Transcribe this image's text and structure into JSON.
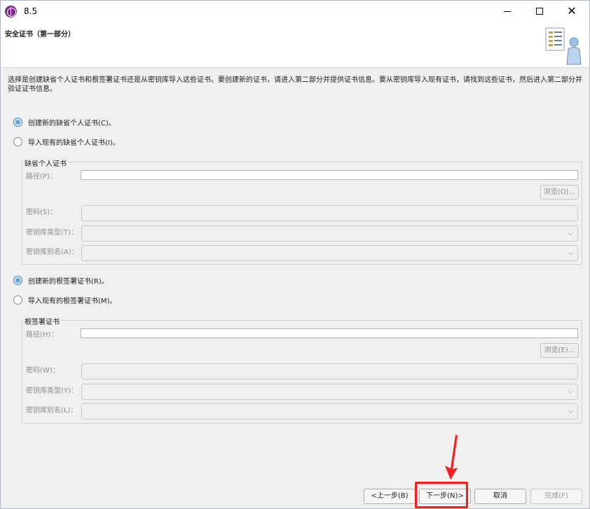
{
  "window": {
    "title": "8.5",
    "header_title": "安全证书（第一部分）"
  },
  "description": "选择是创建缺省个人证书和根签署证书还是从密钥库导入这些证书。要创建新的证书，请进入第二部分并提供证书信息。要从密钥库导入现有证书，请找到这些证书，然后进入第二部分并验证证书信息。",
  "personal": {
    "create_label": "创建新的缺省个人证书(C)。",
    "import_label": "导入现有的缺省个人证书(I)。",
    "selected": "create",
    "group_title": "缺省个人证书",
    "path_label": "路径(P)：",
    "path_value": "",
    "browse_label": "浏览(O)...",
    "password_label": "密码(S)：",
    "keystore_type_label": "密钥库类型(T)：",
    "keystore_alias_label": "密钥库别名(A)："
  },
  "root": {
    "create_label": "创建新的根签署证书(R)。",
    "import_label": "导入现有的根签署证书(M)。",
    "selected": "create",
    "group_title": "根签署证书",
    "path_label": "路径(H)：",
    "path_value": "",
    "browse_label": "浏览(E)...",
    "password_label": "密码(W)：",
    "keystore_type_label": "密钥库类型(Y)：",
    "keystore_alias_label": "密钥库别名(L)："
  },
  "buttons": {
    "back": "<上一步(B)",
    "next": "下一步(N)>",
    "cancel": "取消",
    "finish": "完成(F)"
  },
  "icons": {
    "chevron": "⌵",
    "close": "✕"
  },
  "colors": {
    "highlight": "#ff1a1a"
  }
}
